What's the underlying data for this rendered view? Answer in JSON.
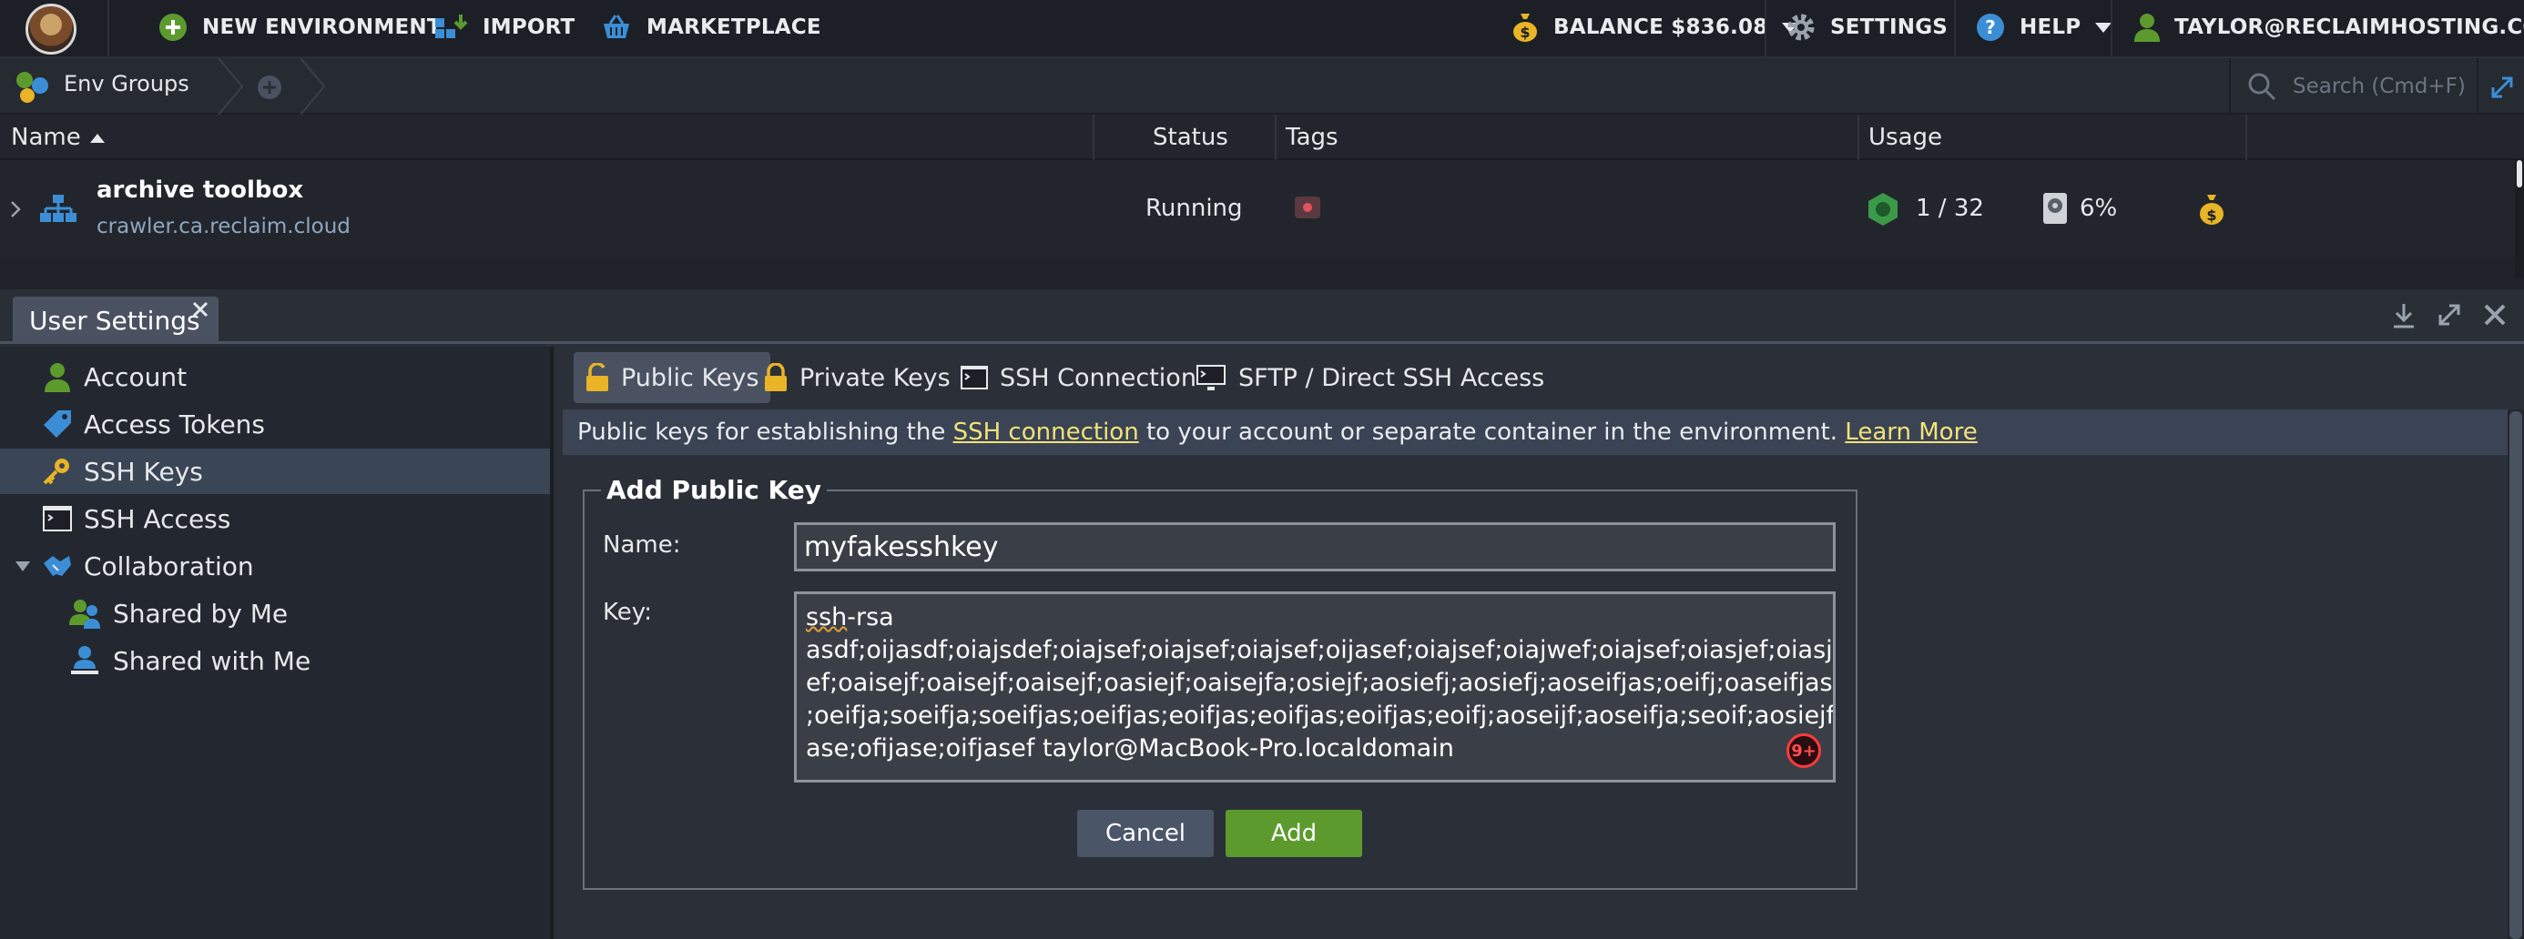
{
  "topbar": {
    "new_env": "NEW ENVIRONMENT",
    "import": "IMPORT",
    "marketplace": "MARKETPLACE",
    "balance": "BALANCE $836.08",
    "settings": "SETTINGS",
    "help": "HELP",
    "user": "TAYLOR@RECLAIMHOSTING.COM"
  },
  "groupbar": {
    "label": "Env Groups",
    "search_placeholder": "Search (Cmd+F)"
  },
  "columns": {
    "name": "Name",
    "status": "Status",
    "tags": "Tags",
    "usage": "Usage"
  },
  "env": {
    "name": "archive toolbox",
    "domain": "crawler.ca.reclaim.cloud",
    "status": "Running",
    "cloudlets": "1 / 32",
    "disk": "6%"
  },
  "panel": {
    "tab": "User Settings"
  },
  "sidebar": {
    "items": [
      {
        "label": "Account"
      },
      {
        "label": "Access Tokens"
      },
      {
        "label": "SSH Keys"
      },
      {
        "label": "SSH Access"
      },
      {
        "label": "Collaboration"
      },
      {
        "label": "Shared by Me"
      },
      {
        "label": "Shared with Me"
      }
    ]
  },
  "content": {
    "tabs": [
      {
        "label": "Public Keys"
      },
      {
        "label": "Private Keys"
      },
      {
        "label": "SSH Connection"
      },
      {
        "label": "SFTP / Direct SSH Access"
      }
    ],
    "info_prefix": "Public keys for establishing the ",
    "info_link": "SSH connection",
    "info_middle": " to your account or separate container in the environment. ",
    "info_learn": "Learn More"
  },
  "form": {
    "legend": "Add Public Key",
    "name_label": "Name:",
    "name_value": "myfakesshkey",
    "key_label": "Key:",
    "key_line1_a": "ssh",
    "key_line1_b": "-rsa",
    "key_line2": "asdf;oijasdf;oiajsdef;oiajsef;oiajsef;oiajsef;oijasef;oiajsef;oiajwef;oiajsef;oiasjef;oiasj",
    "key_line3": "ef;oaisejf;oaisejf;oaisejf;oasiejf;oaisejfa;osiejf;aosiefj;aosiefj;aoseifjas;oeifj;oaseifjas",
    "key_line4": ";oeifja;soeifja;soeifjas;oeifjas;eoifjas;eoifjas;eoifjas;eoifj;aoseijf;aoseifja;seoif;aosiejf",
    "key_line5": "ase;ofijase;oifjasef taylor@MacBook-Pro.localdomain",
    "badge": "9+",
    "cancel": "Cancel",
    "add": "Add"
  },
  "colors": {
    "accent_green": "#5c9a2e",
    "link_yellow": "#f2e27a",
    "badge_red": "#ff3b3b"
  }
}
